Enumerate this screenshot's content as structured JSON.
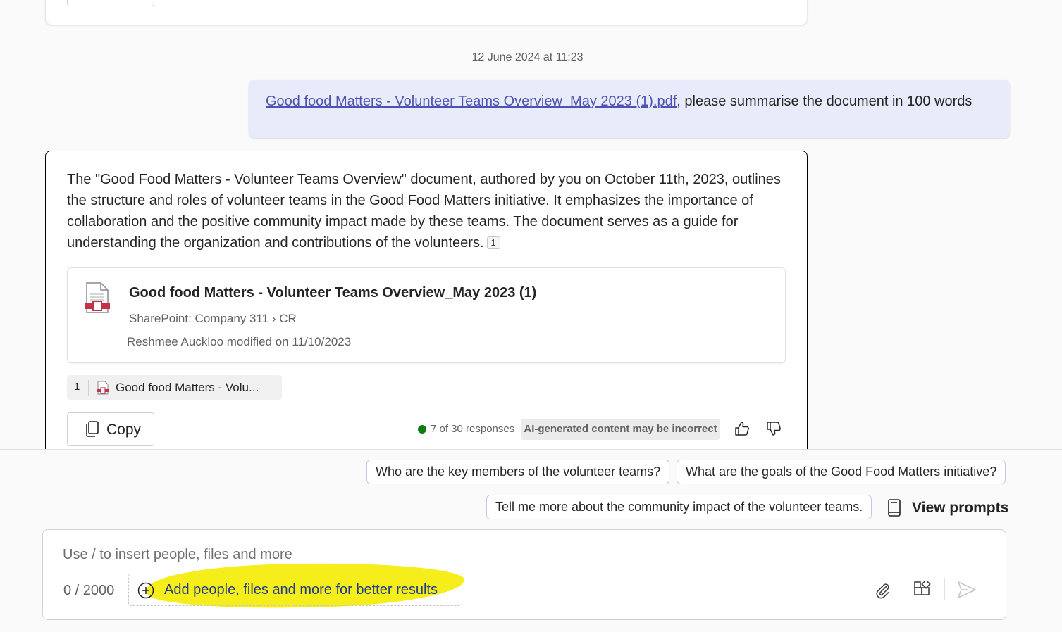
{
  "conversation": {
    "timestamp": "12 June 2024 at 11:23",
    "user_message": {
      "link_text": "Good food Matters - Volunteer Teams Overview_May 2023 (1).pdf",
      "text": ", please summarise the document in 100 words"
    },
    "response": {
      "text": "The \"Good Food Matters - Volunteer Teams Overview\" document, authored by you on October 11th, 2023, outlines the structure and roles of volunteer teams in the Good Food Matters initiative. It emphasizes the importance of collaboration and the positive community impact made by these teams. The document serves as a guide for understanding the organization and contributions of the volunteers.",
      "citation": "1",
      "document_card": {
        "title": "Good food Matters - Volunteer Teams Overview_May 2023 (1)",
        "source": "SharePoint: Company 311",
        "path_sep": "›",
        "folder": "CR",
        "modified": "Reshmee Auckloo modified on 11/10/2023",
        "icon": "pdf-file-icon"
      },
      "reference": {
        "number": "1",
        "label": "Good food Matters - Volu..."
      },
      "copy_label": "Copy",
      "status": "7 of 30 responses",
      "disclaimer": "AI-generated content may be incorrect"
    }
  },
  "suggestions": [
    "Who are the key members of the volunteer teams?",
    "What are the goals of the Good Food Matters initiative?",
    "Tell me more about the community impact of the volunteer teams."
  ],
  "view_prompts_label": "View prompts",
  "composer": {
    "placeholder": "Use / to insert people, files and more",
    "char_count": "0 / 2000",
    "add_context_label": "Add people, files and more for better results"
  },
  "colors": {
    "user_bubble": "#e8ebfa",
    "link": "#4f52b2",
    "status_dot": "#107c10",
    "highlight": "#f5ee1a"
  }
}
